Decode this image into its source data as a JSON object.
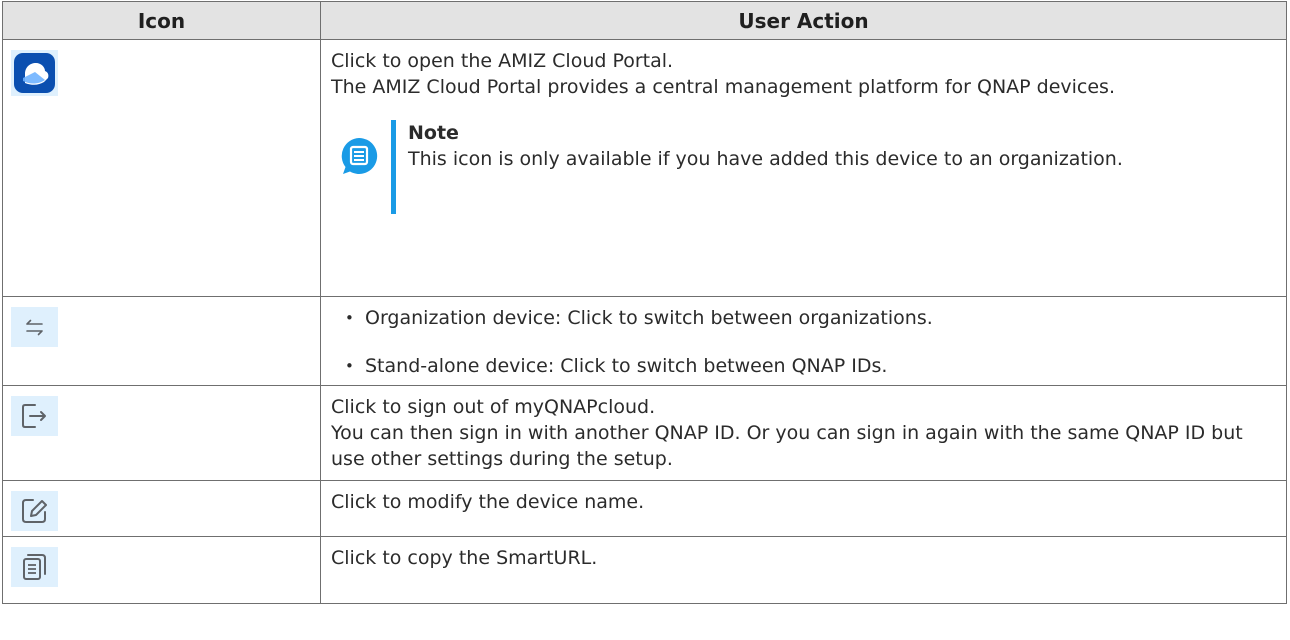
{
  "table": {
    "headers": {
      "icon": "Icon",
      "action": "User Action"
    },
    "rows": [
      {
        "icon": "amiz-cloud-icon",
        "lines": [
          "Click to open the AMIZ Cloud Portal.",
          "The AMIZ Cloud Portal provides a central management platform for QNAP devices."
        ],
        "note": {
          "icon": "note-icon",
          "title": "Note",
          "text": "This icon is only available if you have added this device to an organization."
        }
      },
      {
        "icon": "switch-arrows-icon",
        "bullets": [
          "Organization device: Click to switch between organizations.",
          "Stand-alone device: Click to switch between QNAP IDs."
        ]
      },
      {
        "icon": "sign-out-icon",
        "lines": [
          "Click to sign out of myQNAPcloud.",
          "You can then sign in with another QNAP ID. Or you can sign in again with the same QNAP ID but use other settings during the setup."
        ]
      },
      {
        "icon": "edit-icon",
        "lines": [
          "Click to modify the device name."
        ]
      },
      {
        "icon": "copy-icon",
        "lines": [
          "Click to copy the SmartURL."
        ]
      }
    ]
  },
  "colors": {
    "header_bg": "#e3e3e3",
    "border": "#6f6f6f",
    "icon_bg": "#dff0fd",
    "accent": "#1a9be6",
    "amiz_icon": "#0b4fb0"
  }
}
